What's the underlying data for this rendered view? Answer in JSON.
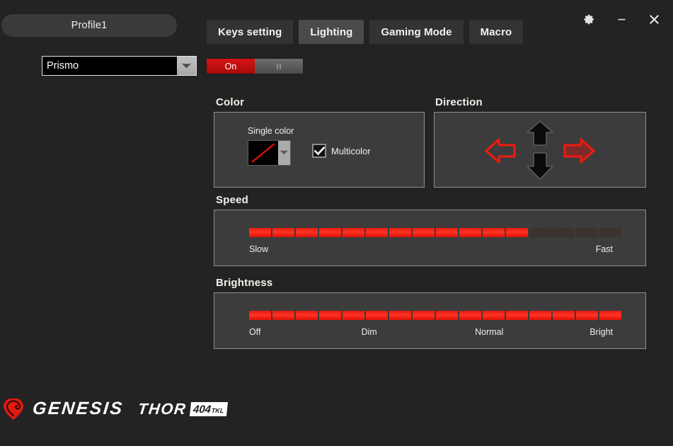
{
  "window": {
    "profile_tab_label": "Profile1",
    "controls": [
      {
        "name": "settings",
        "icon": "gear-icon"
      },
      {
        "name": "minimize",
        "icon": "minimize-icon"
      },
      {
        "name": "close",
        "icon": "close-icon"
      }
    ]
  },
  "tabs": [
    {
      "label": "Keys setting",
      "active": false
    },
    {
      "label": "Lighting",
      "active": true
    },
    {
      "label": "Gaming Mode",
      "active": false
    },
    {
      "label": "Macro",
      "active": false
    }
  ],
  "effect_select": {
    "value": "Prismo",
    "icon": "chevron-down-icon"
  },
  "power_toggle": {
    "on_label": "On",
    "state": "on"
  },
  "color_section": {
    "title": "Color",
    "single_color_label": "Single color",
    "swatch_color": "#000000",
    "swatch_slash_color": "#e01208",
    "swatch_arrow_icon": "chevron-down-icon",
    "multicolor_label": "Multicolor",
    "multicolor_checked": true
  },
  "direction_section": {
    "title": "Direction",
    "arrows": [
      {
        "name": "up",
        "state": "inactive"
      },
      {
        "name": "down",
        "state": "inactive"
      },
      {
        "name": "left",
        "state": "outline"
      },
      {
        "name": "right",
        "state": "selected"
      }
    ]
  },
  "speed_section": {
    "title": "Speed",
    "total_segments": 16,
    "filled_segments": 12,
    "labels": [
      {
        "text": "Slow",
        "pos": 0
      },
      {
        "text": "Fast",
        "pos": 100
      }
    ]
  },
  "brightness_section": {
    "title": "Brightness",
    "total_segments": 16,
    "filled_segments": 16,
    "labels": [
      {
        "text": "Off",
        "pos": 0
      },
      {
        "text": "Dim",
        "pos": 33
      },
      {
        "text": "Normal",
        "pos": 66
      },
      {
        "text": "Bright",
        "pos": 100
      }
    ]
  },
  "footer": {
    "brand": "GENESIS",
    "model": "THOR",
    "model_number": "404",
    "model_suffix": "TKL",
    "logo_icon": "genesis-spiral-logo"
  },
  "colors": {
    "background": "#232323",
    "panel": "#3c3c3c",
    "panel_border": "#8e8e8e",
    "accent_red": "#e01208",
    "tab_active": "#4a4a4a",
    "tab_inactive": "#333333"
  }
}
